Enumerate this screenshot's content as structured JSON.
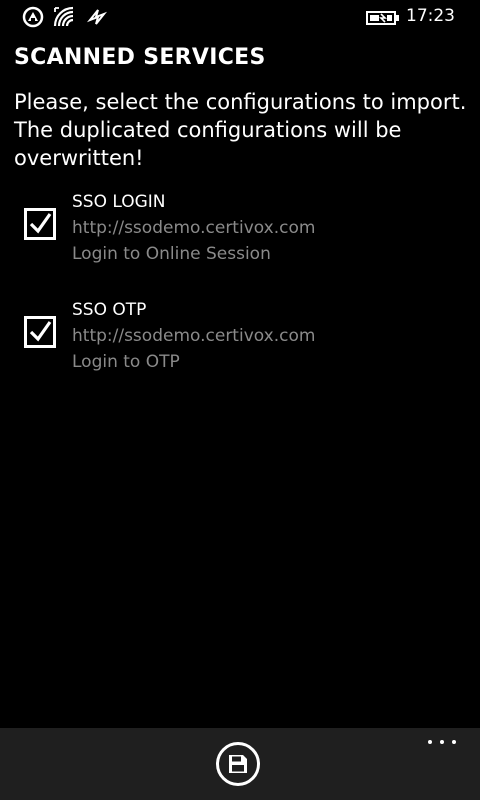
{
  "status_bar": {
    "time": "17:23"
  },
  "page": {
    "title": "SCANNED SERVICES",
    "instruction": "Please, select the configurations to import. The duplicated configurations will be overwritten!"
  },
  "services": [
    {
      "name": "SSO LOGIN",
      "url": "http://ssodemo.certivox.com",
      "description": "Login to Online Session",
      "checked": true
    },
    {
      "name": "SSO OTP",
      "url": "http://ssodemo.certivox.com",
      "description": "Login to OTP",
      "checked": true
    }
  ],
  "app_bar": {
    "primary_icon": "save-icon",
    "more_icon": "more-ellipsis-icon"
  }
}
